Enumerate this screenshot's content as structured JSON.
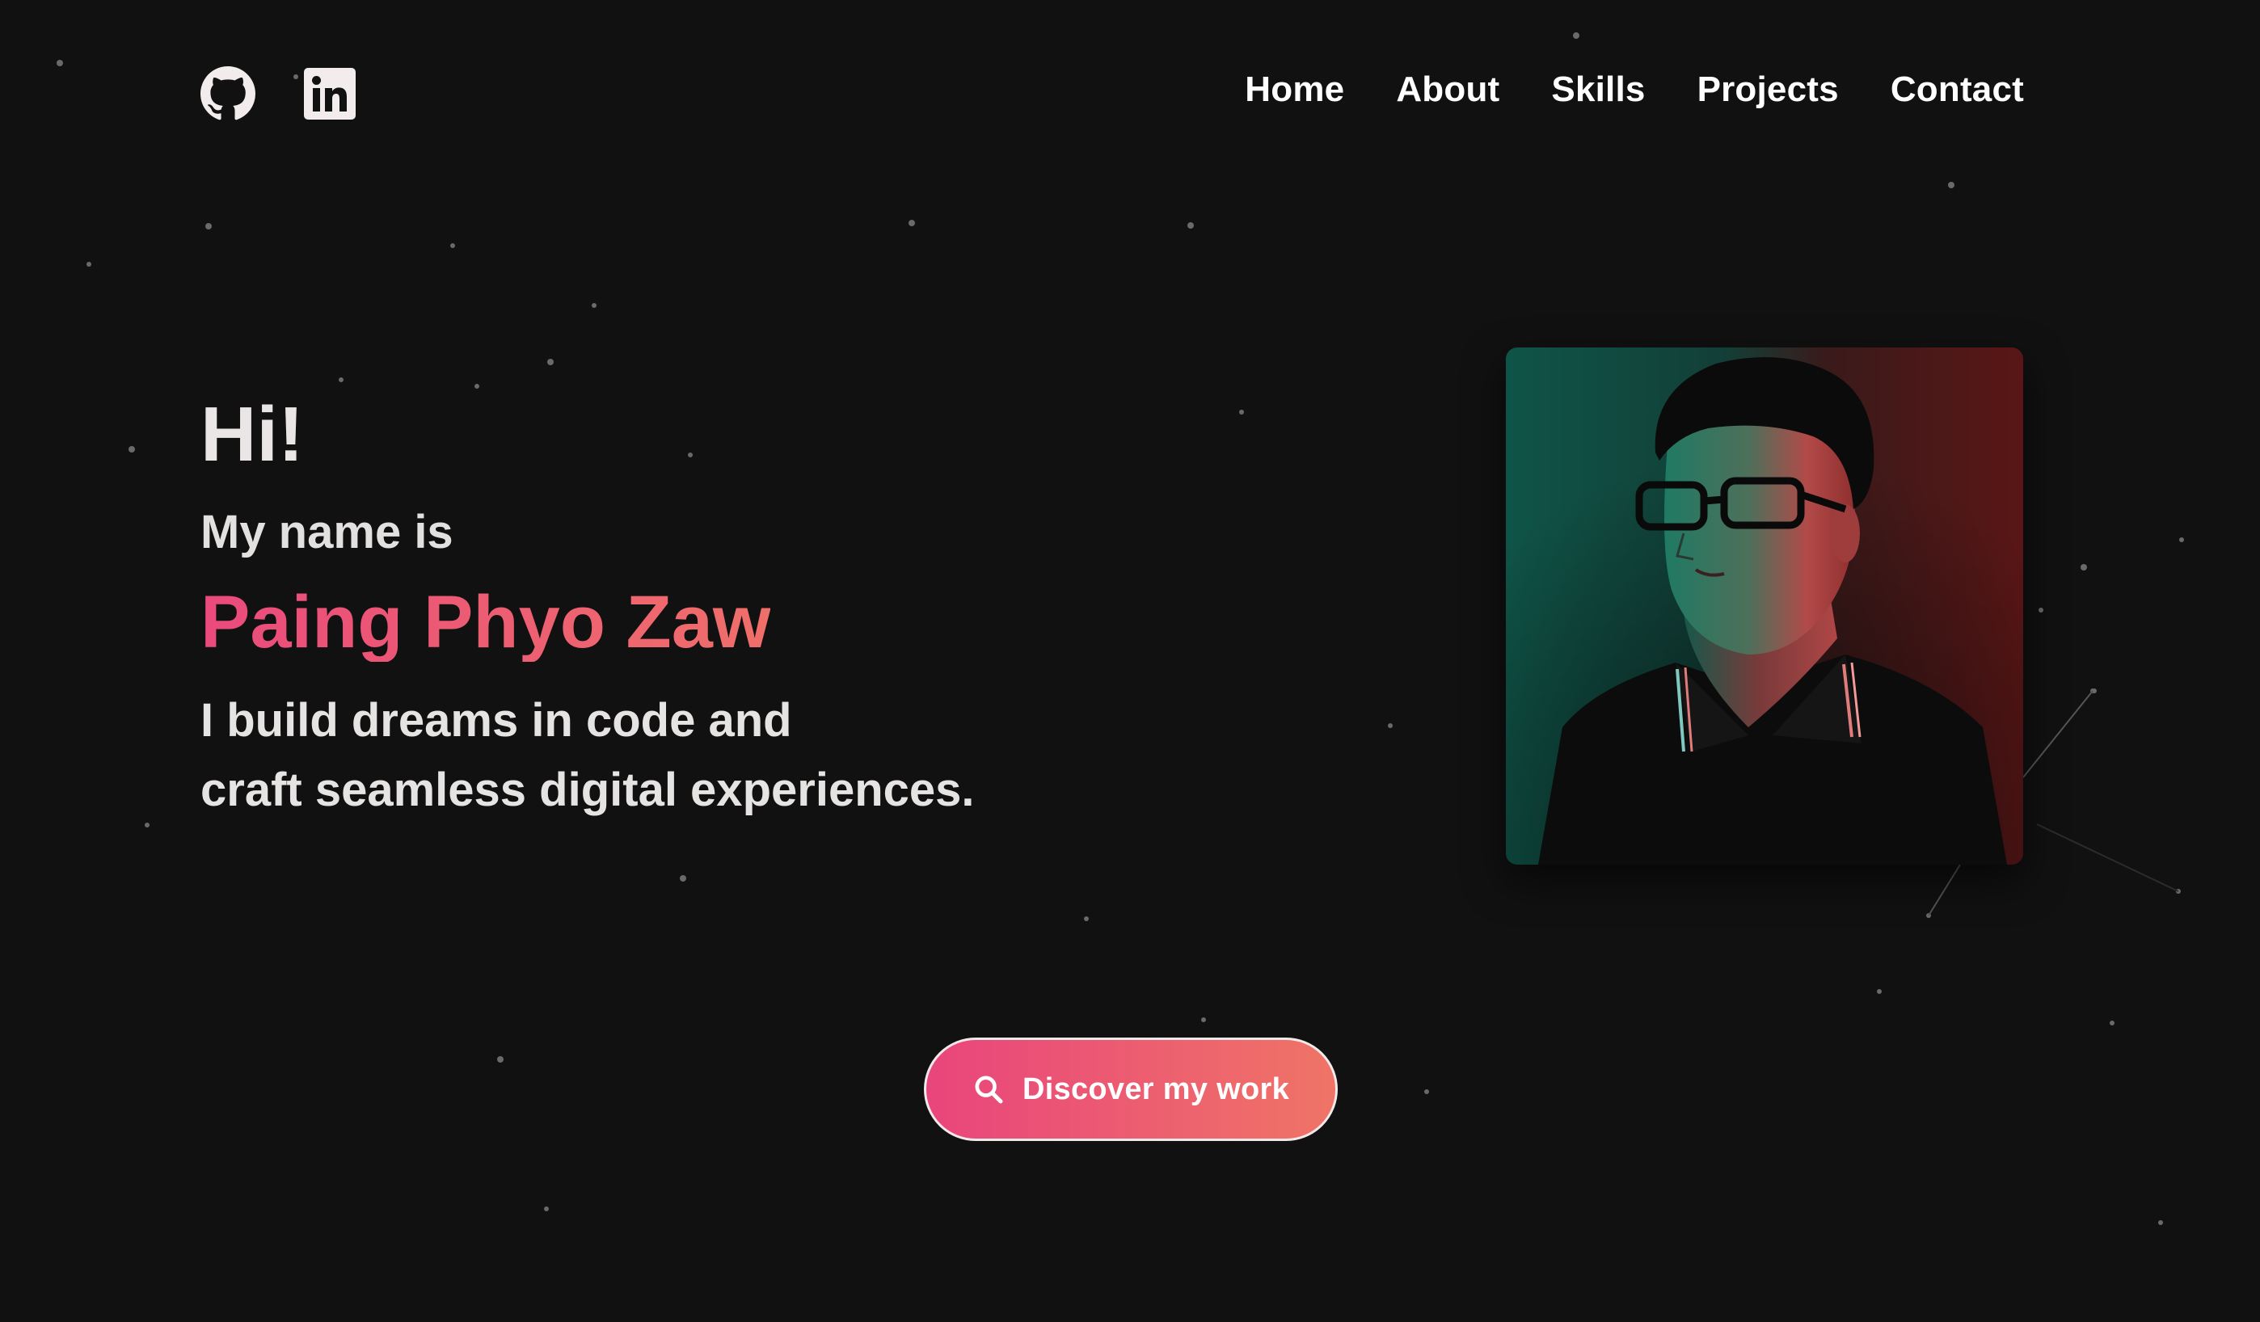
{
  "header": {
    "social": [
      {
        "name": "github-icon"
      },
      {
        "name": "linkedin-icon"
      }
    ],
    "nav": [
      {
        "label": "Home"
      },
      {
        "label": "About"
      },
      {
        "label": "Skills"
      },
      {
        "label": "Projects"
      },
      {
        "label": "Contact"
      }
    ]
  },
  "hero": {
    "greeting": "Hi!",
    "intro": "My name is",
    "name": "Paing Phyo Zaw",
    "tagline_line1": "I build dreams in code and",
    "tagline_line2": "craft seamless digital experiences."
  },
  "cta": {
    "label": "Discover my work",
    "icon": "search-icon"
  },
  "colors": {
    "background": "#111111",
    "accent_start": "#ea4a7c",
    "accent_end": "#ef6f6a"
  }
}
